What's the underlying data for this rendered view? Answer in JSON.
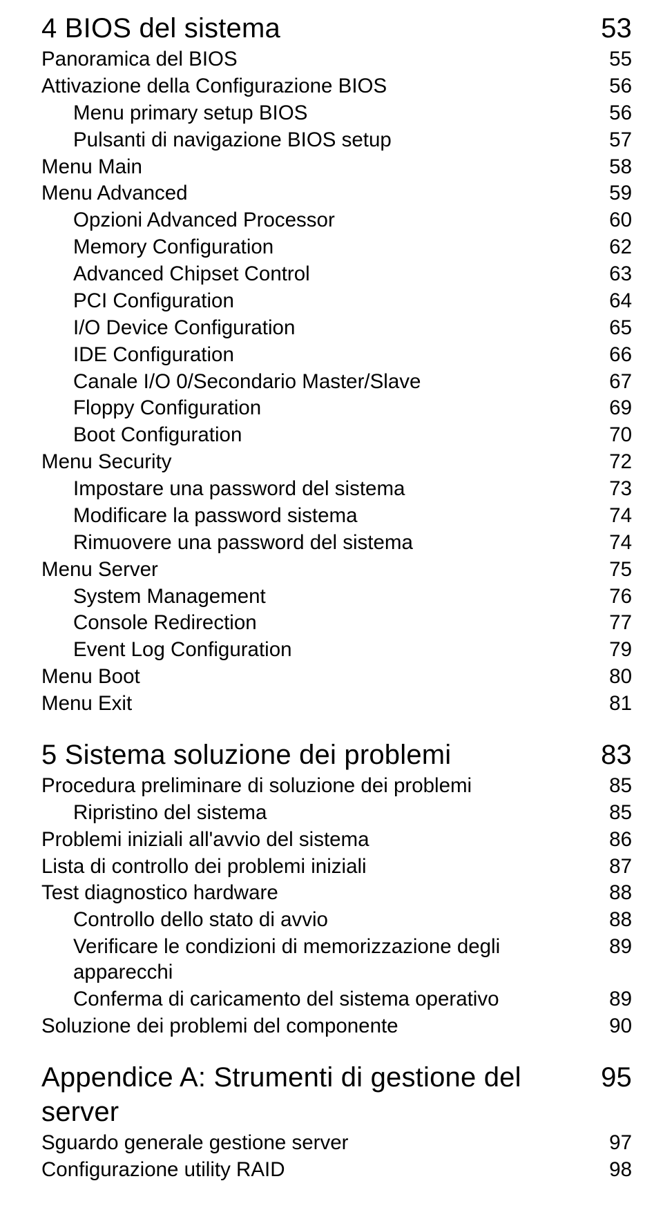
{
  "sections": [
    {
      "title": "4 BIOS del sistema",
      "page": "53",
      "entries": [
        {
          "label": "Panoramica del BIOS",
          "page": "55",
          "level": 0
        },
        {
          "label": "Attivazione della Configurazione BIOS",
          "page": "56",
          "level": 0
        },
        {
          "label": "Menu primary setup BIOS",
          "page": "56",
          "level": 1
        },
        {
          "label": "Pulsanti di navigazione BIOS setup",
          "page": "57",
          "level": 1
        },
        {
          "label": "Menu Main",
          "page": "58",
          "level": 0
        },
        {
          "label": "Menu Advanced",
          "page": "59",
          "level": 0
        },
        {
          "label": "Opzioni Advanced Processor",
          "page": "60",
          "level": 1
        },
        {
          "label": "Memory Configuration",
          "page": "62",
          "level": 1
        },
        {
          "label": "Advanced Chipset Control",
          "page": "63",
          "level": 1
        },
        {
          "label": "PCI Configuration",
          "page": "64",
          "level": 1
        },
        {
          "label": "I/O Device Configuration",
          "page": "65",
          "level": 1
        },
        {
          "label": "IDE Configuration",
          "page": "66",
          "level": 1
        },
        {
          "label": "Canale I/O 0/Secondario Master/Slave",
          "page": "67",
          "level": 1
        },
        {
          "label": "Floppy Configuration",
          "page": "69",
          "level": 1
        },
        {
          "label": "Boot Configuration",
          "page": "70",
          "level": 1
        },
        {
          "label": "Menu Security",
          "page": "72",
          "level": 0
        },
        {
          "label": "Impostare una password del sistema",
          "page": "73",
          "level": 1
        },
        {
          "label": "Modificare la password sistema",
          "page": "74",
          "level": 1
        },
        {
          "label": "Rimuovere una password del sistema",
          "page": "74",
          "level": 1
        },
        {
          "label": "Menu Server",
          "page": "75",
          "level": 0
        },
        {
          "label": "System Management",
          "page": "76",
          "level": 1
        },
        {
          "label": "Console Redirection",
          "page": "77",
          "level": 1
        },
        {
          "label": "Event Log Configuration",
          "page": "79",
          "level": 1
        },
        {
          "label": "Menu Boot",
          "page": "80",
          "level": 0
        },
        {
          "label": "Menu Exit",
          "page": "81",
          "level": 0
        }
      ]
    },
    {
      "title": "5 Sistema soluzione dei problemi",
      "page": "83",
      "entries": [
        {
          "label": "Procedura preliminare di soluzione dei problemi",
          "page": "85",
          "level": 0
        },
        {
          "label": "Ripristino del sistema",
          "page": "85",
          "level": 1
        },
        {
          "label": "Problemi iniziali all'avvio del sistema",
          "page": "86",
          "level": 0
        },
        {
          "label": "Lista di controllo dei problemi iniziali",
          "page": "87",
          "level": 0
        },
        {
          "label": "Test diagnostico hardware",
          "page": "88",
          "level": 0
        },
        {
          "label": "Controllo dello stato di avvio",
          "page": "88",
          "level": 1
        },
        {
          "label": "Verificare le condizioni di memorizzazione degli apparecchi",
          "page": "89",
          "level": 1
        },
        {
          "label": "Conferma di caricamento del sistema operativo",
          "page": "89",
          "level": 1
        },
        {
          "label": "Soluzione dei problemi del componente",
          "page": "90",
          "level": 0
        }
      ]
    },
    {
      "title": "Appendice A: Strumenti di gestione del server",
      "page": "95",
      "entries": [
        {
          "label": "Sguardo generale gestione server",
          "page": "97",
          "level": 0
        },
        {
          "label": "Configurazione utility RAID",
          "page": "98",
          "level": 0
        }
      ]
    }
  ]
}
